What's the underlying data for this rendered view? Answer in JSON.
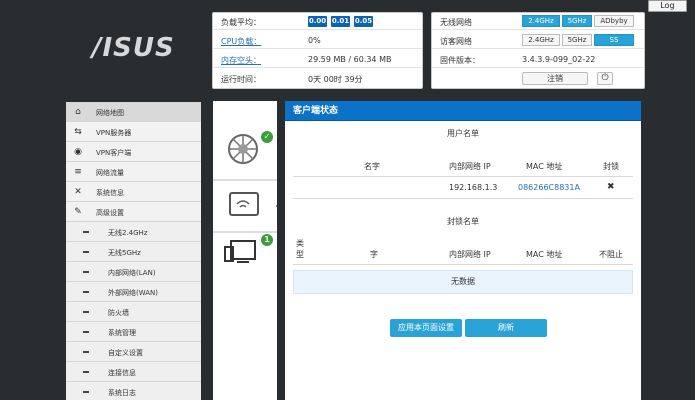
{
  "brand": {
    "logo_text": "/ISUS"
  },
  "header": {
    "logout_label": "Log"
  },
  "status": {
    "load_label": "负载平均：",
    "load_values": [
      "0.00",
      "0.01",
      "0.05"
    ],
    "cpu_label": "CPU负载：",
    "cpu_value": "0%",
    "mem_label": "内存空头：",
    "mem_value": "29.59 MB / 60.34 MB",
    "uptime_label": "运行时间：",
    "uptime_value": "0天 00时 39分"
  },
  "wireless": {
    "wifi_label": "无线网络",
    "wifi_buttons": [
      "2.4GHz",
      "5GHz",
      "ADbyby"
    ],
    "guest_label": "访客网络",
    "guest_buttons": [
      "2.4GHz",
      "5GHz",
      "SS"
    ],
    "fw_label": "固件版本：",
    "fw_value": "3.4.3.9-099_02-22",
    "logout_btn": "注销",
    "reboot_icon": "⏻"
  },
  "sidebar": {
    "items": [
      {
        "label": "网络地图",
        "icon": "⌂"
      },
      {
        "label": "VPN服务器",
        "icon": "⇆"
      },
      {
        "label": "VPN客户端",
        "icon": "◉"
      },
      {
        "label": "网络流量",
        "icon": "≡"
      },
      {
        "label": "系统信息",
        "icon": "✕"
      },
      {
        "label": "高级设置",
        "icon": "✎"
      }
    ],
    "subitems": [
      "无线2.4GHz",
      "无线5GHz",
      "内部网络(LAN)",
      "外部网络(WAN)",
      "防火墙",
      "系统管理",
      "自定义设置",
      "连接信息",
      "系统日志"
    ]
  },
  "badges": {
    "net": "✓",
    "mon": "1"
  },
  "clients": {
    "title": "客户端状态",
    "user_list_title": "用户名单",
    "cols1": [
      "名字",
      "内部网络 IP",
      "MAC 地址",
      "封锁"
    ],
    "rows": [
      {
        "ip": "192.168.1.3",
        "mac": "086266C8831A",
        "block": "✖"
      }
    ],
    "block_list_title": "封锁名单",
    "cols2_type_a": "类",
    "cols2_type_b": "型",
    "cols2": [
      "字",
      "内部网络 IP",
      "MAC 地址",
      "不阻止"
    ],
    "no_data": "无数据",
    "apply_btn": "应用本页面设置",
    "refresh_btn": "刷新"
  }
}
